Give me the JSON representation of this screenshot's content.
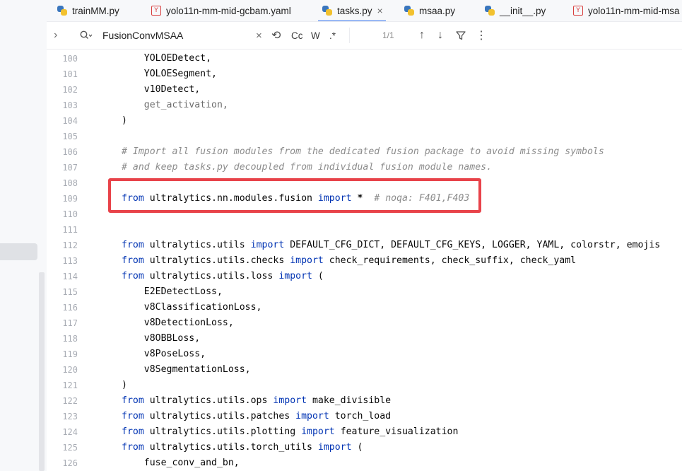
{
  "tabs": [
    {
      "label": "trainMM.py",
      "icon": "python-file-icon"
    },
    {
      "label": "yolo11n-mm-mid-gcbam.yaml",
      "icon": "yaml-file-icon"
    },
    {
      "label": "tasks.py",
      "icon": "python-file-icon",
      "active": true,
      "close": "×"
    },
    {
      "label": "msaa.py",
      "icon": "python-file-icon"
    },
    {
      "label": "__init__.py",
      "icon": "python-file-icon"
    },
    {
      "label": "yolo11n-mm-mid-msa",
      "icon": "yaml-file-icon"
    }
  ],
  "search": {
    "expand": "›",
    "query": "FusionConvMSAA",
    "clear": "×",
    "replace_icon": "⟲",
    "case": "Cc",
    "words": "W",
    "regex": ".*",
    "match_count": "1/1",
    "prev": "↑",
    "next": "↓",
    "filter": "⊽",
    "more": "⋮"
  },
  "lines": [
    {
      "n": "100",
      "t": "    YOLOEDetect,"
    },
    {
      "n": "101",
      "t": "    YOLOESegment,"
    },
    {
      "n": "102",
      "t": "    v10Detect,"
    },
    {
      "n": "103",
      "t": "    get_activation,"
    },
    {
      "n": "104",
      "t": ")"
    },
    {
      "n": "105",
      "t": ""
    },
    {
      "n": "106",
      "t": "# Import all fusion modules from the dedicated fusion package to avoid missing symbols"
    },
    {
      "n": "107",
      "t": "# and keep tasks.py decoupled from individual fusion module names."
    },
    {
      "n": "108",
      "t": ""
    },
    {
      "n": "109",
      "a": "from",
      "b": " ultralytics.nn.modules.fusion ",
      "c": "import",
      "d": " *",
      "e": "  # noqa: F401,F403"
    },
    {
      "n": "110",
      "t": ""
    },
    {
      "n": "111",
      "t": ""
    },
    {
      "n": "112",
      "a": "from",
      "b": " ultralytics.utils ",
      "c": "import",
      "d": " DEFAULT_CFG_DICT, DEFAULT_CFG_KEYS, LOGGER, YAML, colorstr, emojis"
    },
    {
      "n": "113",
      "a": "from",
      "b": " ultralytics.utils.checks ",
      "c": "import",
      "d": " check_requirements, check_suffix, check_yaml"
    },
    {
      "n": "114",
      "a": "from",
      "b": " ultralytics.utils.loss ",
      "c": "import",
      "d": " ("
    },
    {
      "n": "115",
      "t": "    E2EDetectLoss,"
    },
    {
      "n": "116",
      "t": "    v8ClassificationLoss,"
    },
    {
      "n": "117",
      "t": "    v8DetectionLoss,"
    },
    {
      "n": "118",
      "t": "    v8OBBLoss,"
    },
    {
      "n": "119",
      "t": "    v8PoseLoss,"
    },
    {
      "n": "120",
      "t": "    v8SegmentationLoss,"
    },
    {
      "n": "121",
      "t": ")"
    },
    {
      "n": "122",
      "a": "from",
      "b": " ultralytics.utils.ops ",
      "c": "import",
      "d": " make_divisible"
    },
    {
      "n": "123",
      "a": "from",
      "b": " ultralytics.utils.patches ",
      "c": "import",
      "d": " torch_load"
    },
    {
      "n": "124",
      "a": "from",
      "b": " ultralytics.utils.plotting ",
      "c": "import",
      "d": " feature_visualization"
    },
    {
      "n": "125",
      "a": "from",
      "b": " ultralytics.utils.torch_utils ",
      "c": "import",
      "d": " ("
    },
    {
      "n": "126",
      "t": "    fuse_conv_and_bn,"
    }
  ]
}
